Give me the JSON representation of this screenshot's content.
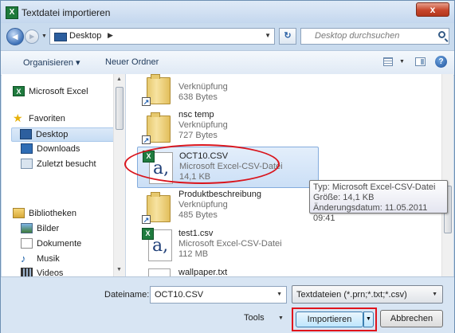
{
  "window": {
    "title": "Textdatei importieren",
    "close_label": "x"
  },
  "address": {
    "location": "Desktop",
    "search_placeholder": "Desktop durchsuchen"
  },
  "toolbar": {
    "organize_label": "Organisieren ▾",
    "new_folder_label": "Neuer Ordner"
  },
  "sidebar": {
    "items": [
      {
        "label": "Microsoft Excel"
      },
      {
        "label": "Favoriten"
      },
      {
        "label": "Desktop"
      },
      {
        "label": "Downloads"
      },
      {
        "label": "Zuletzt besucht"
      },
      {
        "label": "Bibliotheken"
      },
      {
        "label": "Bilder"
      },
      {
        "label": "Dokumente"
      },
      {
        "label": "Musik"
      },
      {
        "label": "Videos"
      }
    ]
  },
  "files": [
    {
      "name": "",
      "type": "Verknüpfung",
      "size": "638 Bytes"
    },
    {
      "name": "nsc temp",
      "type": "Verknüpfung",
      "size": "727 Bytes"
    },
    {
      "name": "OCT10.CSV",
      "type": "Microsoft Excel-CSV-Datei",
      "size": "14,1 KB"
    },
    {
      "name": "Produktbeschreibung",
      "type": "Verknüpfung",
      "size": "485 Bytes"
    },
    {
      "name": "test1.csv",
      "type": "Microsoft Excel-CSV-Datei",
      "size": "112 MB"
    },
    {
      "name": "wallpaper.txt",
      "type": "",
      "size": ""
    }
  ],
  "tooltip": {
    "type_line": "Typ: Microsoft Excel-CSV-Datei",
    "size_line": "Größe: 14,1 KB",
    "date_line": "Änderungsdatum: 11.05.2011 09:41"
  },
  "bottom": {
    "filename_label": "Dateiname:",
    "filename_value": "OCT10.CSV",
    "filetype_value": "Textdateien (*.prn;*.txt;*.csv)",
    "tools_label": "Tools",
    "import_label": "Importieren",
    "cancel_label": "Abbrechen"
  },
  "annotations": {
    "highlight_color": "#d9151d"
  }
}
